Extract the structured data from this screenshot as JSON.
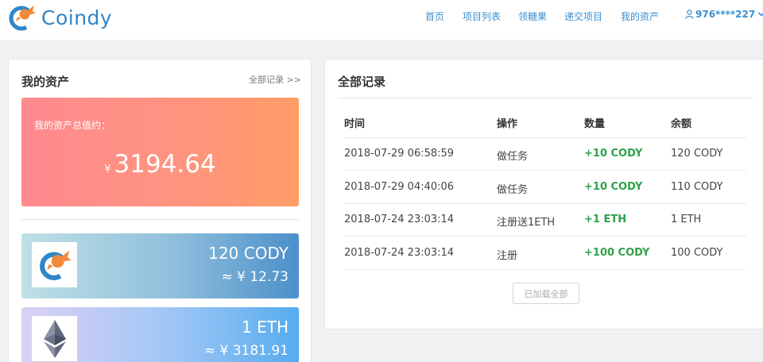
{
  "brand": {
    "name": "Coindy",
    "accent": "#2f86c8",
    "orange": "#f28a3a"
  },
  "nav": {
    "items": [
      {
        "label": "首页"
      },
      {
        "label": "项目列表"
      },
      {
        "label": "领糖果"
      },
      {
        "label": "递交项目"
      },
      {
        "label": "我的资产"
      }
    ],
    "user": {
      "label": "976****227",
      "icon": "user-icon",
      "dropdown_icon": "chevron-down-icon"
    }
  },
  "assets": {
    "title": "我的资产",
    "all_records_link": "全部记录 >>",
    "total": {
      "label": "我的资产总值约：",
      "currency": "¥",
      "value": "3194.64"
    },
    "cards": [
      {
        "icon": "cody-logo-icon",
        "amount": "120 CODY",
        "value": "≈ ¥ 12.73"
      },
      {
        "icon": "ethereum-icon",
        "amount": "1 ETH",
        "value": "≈ ¥ 3181.91"
      }
    ]
  },
  "records": {
    "title": "全部记录",
    "columns": [
      "时间",
      "操作",
      "数量",
      "余额"
    ],
    "rows": [
      {
        "time": "2018-07-29 06:58:59",
        "action": "做任务",
        "amount": "+10 CODY",
        "balance": "120 CODY"
      },
      {
        "time": "2018-07-29 04:40:06",
        "action": "做任务",
        "amount": "+10 CODY",
        "balance": "110 CODY"
      },
      {
        "time": "2018-07-24 23:03:14",
        "action": "注册送1ETH",
        "amount": "+1 ETH",
        "balance": "1 ETH"
      },
      {
        "time": "2018-07-24 23:03:14",
        "action": "注册",
        "amount": "+100 CODY",
        "balance": "100 CODY"
      }
    ],
    "load_more": "已加载全部",
    "amount_color": "#2fa14a"
  }
}
